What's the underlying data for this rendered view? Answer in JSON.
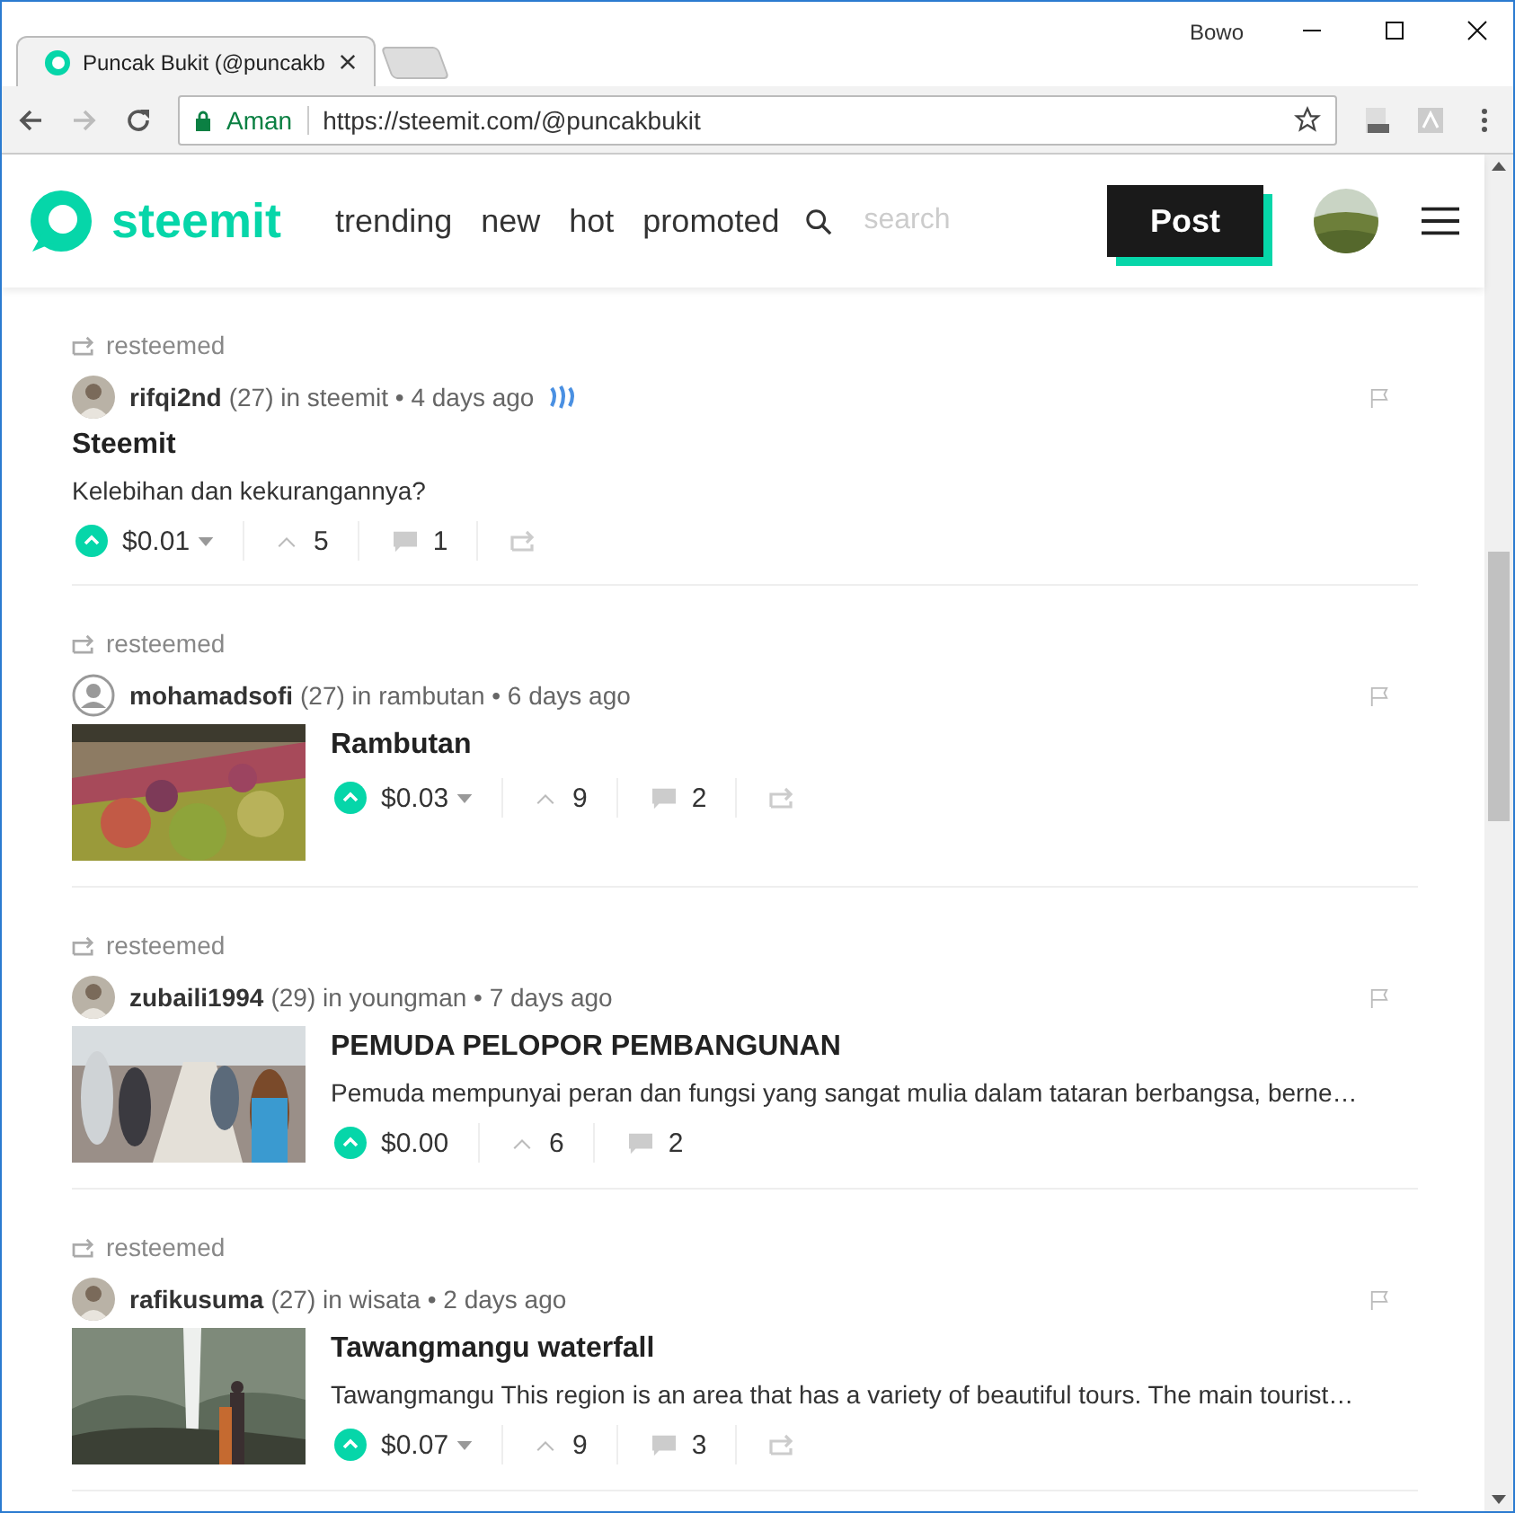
{
  "browser": {
    "user": "Bowo",
    "tab": {
      "title": "Puncak Bukit (@puncakb",
      "selected": true
    },
    "address": {
      "security": "Aman",
      "url": "https://steemit.com/@puncakbukit"
    }
  },
  "header": {
    "logo": "steemit",
    "nav": [
      {
        "label": "trending"
      },
      {
        "label": "new"
      },
      {
        "label": "hot"
      },
      {
        "label": "promoted"
      }
    ],
    "search": {
      "placeholder": "search"
    },
    "post_button": "Post"
  },
  "posts": [
    {
      "resteemed": "resteemed",
      "author": "rifqi2nd",
      "meta": "(27) in steemit • 4 days ago",
      "steem_icon": true,
      "title": "Steemit",
      "excerpt": "Kelebihan dan kekurangannya?",
      "payout": "$0.01",
      "payout_caret": true,
      "votes": "5",
      "comments": "1",
      "resteem_button": true
    },
    {
      "resteemed": "resteemed",
      "avatar": {
        "kind": "default"
      },
      "author": "mohamadsofi",
      "meta": "(27) in rambutan • 6 days ago",
      "steem_icon": false,
      "title": "Rambutan",
      "payout": "$0.03",
      "payout_caret": true,
      "votes": "9",
      "comments": "2",
      "resteem_button": true
    },
    {
      "resteemed": "resteemed",
      "author": "zubaili1994",
      "meta": "(29) in youngman • 7 days ago",
      "steem_icon": false,
      "title": "PEMUDA PELOPOR PEMBANGUNAN",
      "excerpt": "Pemuda mempunyai peran dan fungsi yang sangat mulia dalam tataran berbangsa, berne…",
      "payout": "$0.00",
      "payout_caret": false,
      "votes": "6",
      "comments": "2",
      "resteem_button": false
    },
    {
      "resteemed": "resteemed",
      "author": "rafikusuma",
      "meta": "(27) in wisata • 2 days ago",
      "steem_icon": false,
      "title": "Tawangmangu waterfall",
      "excerpt": "Tawangmangu This region is an area that has a variety of beautiful tours. The main tourist…",
      "payout": "$0.07",
      "payout_caret": true,
      "votes": "9",
      "comments": "3",
      "resteem_button": true
    }
  ]
}
